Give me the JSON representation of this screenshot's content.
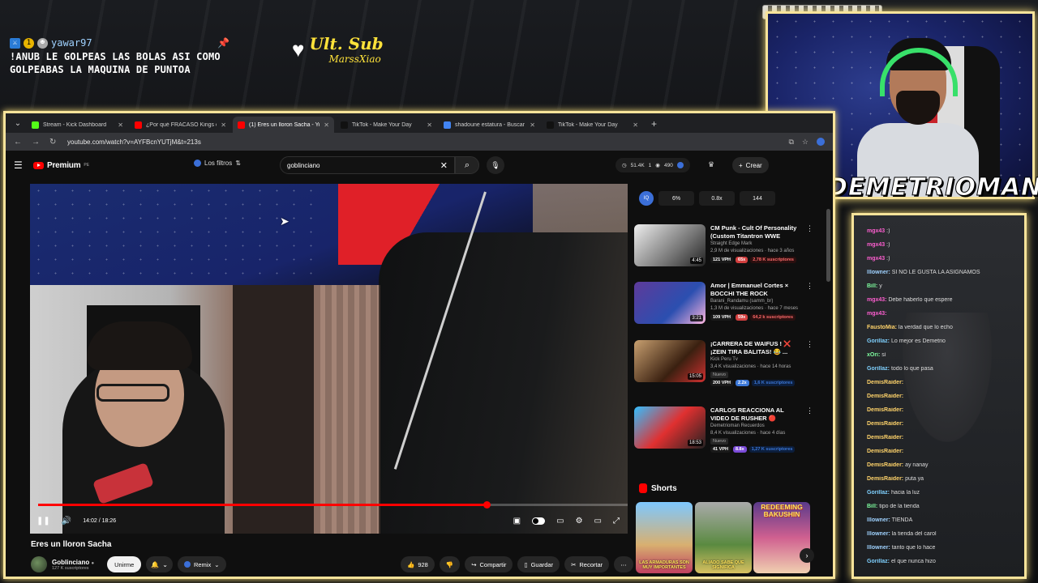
{
  "overlay": {
    "alert_user": "yawar97",
    "alert_badge_num": "1",
    "alert_message": "!ANUB LE GOLPEAS LAS BOLAS ASI COMO GOLPEABAS LA MAQUINA DE PUNTOA",
    "ult_title": "Ult. Sub",
    "ult_name": "MarssXiao",
    "streamer_name": "DEMETRIOMAN"
  },
  "chat": {
    "lines": [
      {
        "user": "mgx43",
        "text": ":)",
        "color": "#ff5fd1"
      },
      {
        "user": "mgx43",
        "text": ":)",
        "color": "#ff5fd1"
      },
      {
        "user": "mgx43",
        "text": ":)",
        "color": "#ff5fd1"
      },
      {
        "user": "lllowner:",
        "text": "SI NO LE GUSTA LA ASIGNAMOS",
        "color": "#9fd2ff"
      },
      {
        "user": "Bill:",
        "text": "y",
        "color": "#7fffa0"
      },
      {
        "user": "mgx43:",
        "text": "Debe haberlo que espere",
        "color": "#ff5fd1"
      },
      {
        "user": "mgx43:",
        "text": "",
        "color": "#ff5fd1"
      },
      {
        "user": "FaustoMia:",
        "text": "la verdad que lo echo",
        "color": "#ffd36a"
      },
      {
        "user": "Gorillaz:",
        "text": "Lo mejor es Demetrio",
        "color": "#7fd1ff"
      },
      {
        "user": "xOri:",
        "text": "sí",
        "color": "#7fffa0"
      },
      {
        "user": "Gorillaz:",
        "text": "todo lo que pasa",
        "color": "#7fd1ff"
      },
      {
        "user": "DemisRaider:",
        "text": "",
        "color": "#ffd36a"
      },
      {
        "user": "DemisRaider:",
        "text": "",
        "color": "#ffd36a"
      },
      {
        "user": "DemisRaider:",
        "text": "",
        "color": "#ffd36a"
      },
      {
        "user": "DemisRaider:",
        "text": "",
        "color": "#ffd36a"
      },
      {
        "user": "DemisRaider:",
        "text": "",
        "color": "#ffd36a"
      },
      {
        "user": "DemisRaider:",
        "text": "",
        "color": "#ffd36a"
      },
      {
        "user": "DemisRaider:",
        "text": "ay nanay",
        "color": "#ffd36a"
      },
      {
        "user": "DemisRaider:",
        "text": "puta ya",
        "color": "#ffd36a"
      },
      {
        "user": "Gorillaz:",
        "text": "hacia la luz",
        "color": "#7fd1ff"
      },
      {
        "user": "Bill:",
        "text": "tipo de la tienda",
        "color": "#7fffa0"
      },
      {
        "user": "lllowner:",
        "text": "TIENDA",
        "color": "#9fd2ff"
      },
      {
        "user": "lllowner:",
        "text": "la tienda del carol",
        "color": "#9fd2ff"
      },
      {
        "user": "lllowner:",
        "text": "tanto que lo hace",
        "color": "#9fd2ff"
      },
      {
        "user": "Gorillaz:",
        "text": "el que nunca hizo",
        "color": "#7fd1ff"
      }
    ]
  },
  "browser": {
    "tabs": [
      {
        "title": "Stream - Kick Dashboard",
        "color": "#53fc18",
        "active": false
      },
      {
        "title": "¿Por qué FRACASO Kings of Ru",
        "color": "#ff0000",
        "active": false
      },
      {
        "title": "(1) Eres un lloron Sacha - Yo",
        "color": "#ff0000",
        "active": true
      },
      {
        "title": "TikTok - Make Your Day",
        "color": "#111111",
        "active": false
      },
      {
        "title": "shadoune estatura - Buscar con",
        "color": "#4285f4",
        "active": false
      },
      {
        "title": "TikTok - Make Your Day",
        "color": "#111111",
        "active": false
      }
    ],
    "url": "youtube.com/watch?v=AYFBcnYUTjM&t=213s"
  },
  "youtube": {
    "logo_text": "Premium",
    "logo_sup": "PE",
    "filters_label": "Los filtros",
    "search_value": "goblinciano",
    "header_stats": {
      "views": "51.4K",
      "count": "1",
      "viewers": "490"
    },
    "create_label": "Crear",
    "video": {
      "title": "Eres un lloron Sacha",
      "current_time": "14:02",
      "duration": "18:26",
      "progress_fraction": 0.761
    },
    "channel": {
      "name": "Goblinciano",
      "subs": "127 K suscriptores",
      "join_label": "Unirme",
      "remix_label": "Remix"
    },
    "actions": {
      "likes": "928",
      "share": "Compartir",
      "save": "Guardar",
      "clip": "Recortar"
    },
    "side_stats": [
      "6%",
      "0.8x",
      "144"
    ],
    "recommendations": [
      {
        "title": "CM Punk - Cult Of Personality (Custom Titantron WWE Retur...",
        "channel": "Straight Edge Mark",
        "meta": "2,9 M de visualizaciones · hace 3 años",
        "duration": "4:45",
        "vph": "121 VPH",
        "x": "65x",
        "subs": "2,78 K suscriptores",
        "new": ""
      },
      {
        "title": "Amor | Emmanuel Cortes × BOCCHI THE ROCK",
        "channel": "Barani_Randamu (samm_br)",
        "meta": "1,3 M de visualizaciones · hace 7 meses",
        "duration": "3:21",
        "vph": "109 VPH",
        "x": "59x",
        "subs": "64,2 k suscriptores",
        "new": ""
      },
      {
        "title": "¡CARRERA DE WAIFUS ! ❌ ¡ZEIN TIRA BALITAS! 😂 ...",
        "channel": "Kick Peru Tv",
        "meta": "3,4 K visualizaciones · hace 14 horas",
        "duration": "15:05",
        "vph": "200 VPH",
        "x": "2.2x",
        "subs": "1,6 K suscriptores",
        "new": "Nuevo"
      },
      {
        "title": "CARLOS REACCIONA AL VIDEO DE RUSHER 🔴 \"SACH...",
        "channel": "Demetrioman Recuerdos",
        "meta": "8,4 K visualizaciones · hace 4 días",
        "duration": "18:53",
        "vph": "41 VPH",
        "x": "8.8x",
        "subs": "1,27 K suscriptores",
        "new": "Nuevo"
      }
    ],
    "shorts_label": "Shorts",
    "shorts": [
      {
        "top": "",
        "label": "LAS ARMADURAS SON MUY IMPORTANTES"
      },
      {
        "top": "",
        "label": "ALIADO SABE QUE SIGNIFICA"
      },
      {
        "top": "REDEEMING BAKUSHIN",
        "label": ""
      }
    ]
  }
}
